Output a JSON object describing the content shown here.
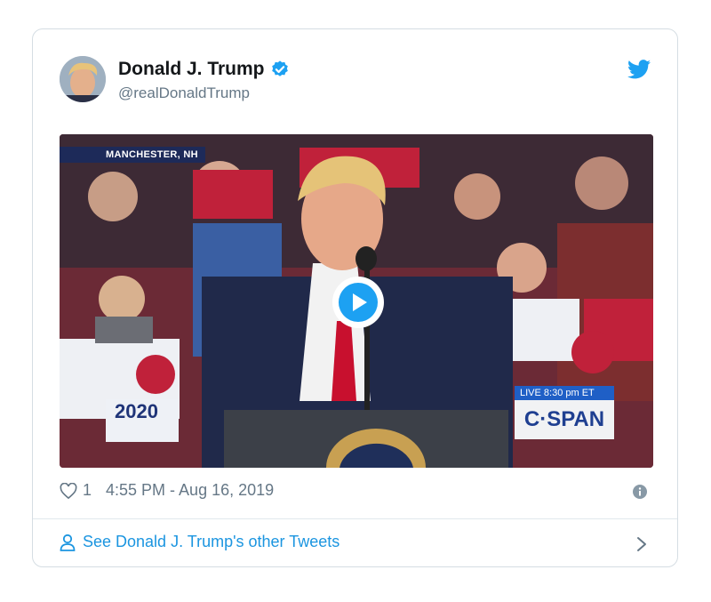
{
  "tweet": {
    "author_name": "Donald J. Trump",
    "author_handle": "@realDonaldTrump",
    "likes": "1",
    "timestamp": "4:55 PM - Aug 16, 2019",
    "other_tweets_link": "See Donald J. Trump's other Tweets"
  },
  "media": {
    "location_banner": "MANCHESTER, NH",
    "live_badge": "LIVE  8:30 pm ET",
    "network_logo": "C·SPAN",
    "campaign_logo": "2020"
  },
  "icons": {
    "verified": "verified-badge-icon",
    "brand": "twitter-bird-icon",
    "like": "heart-icon",
    "info": "info-icon",
    "profile": "person-icon",
    "chevron": "chevron-right-icon"
  },
  "colors": {
    "accent": "#1da1f2",
    "link": "#1b95e0",
    "text": "#14171a",
    "muted": "#657786"
  }
}
